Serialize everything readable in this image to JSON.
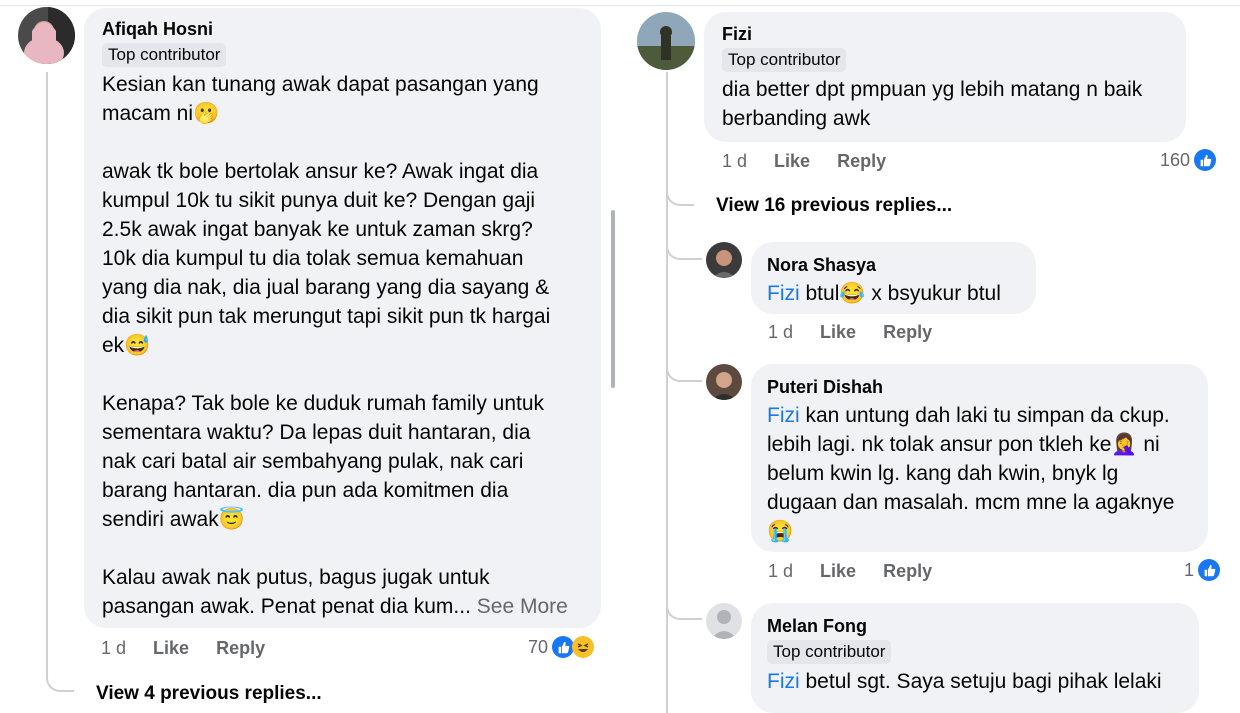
{
  "left": {
    "author": "Afiqah Hosni",
    "badge": "Top contributor",
    "paragraphs": [
      [
        "Kesian kan tunang awak dapat pasangan yang",
        "macam ni🫢"
      ],
      [
        "awak tk bole bertolak ansur ke? Awak ingat dia",
        "kumpul 10k tu sikit punya duit ke? Dengan gaji",
        "2.5k awak ingat banyak ke untuk zaman skrg?",
        "10k dia kumpul tu dia tolak semua kemahuan",
        "yang dia nak, dia jual barang yang dia sayang &",
        "dia sikit pun tak merungut tapi sikit pun tk hargai",
        "ek😅"
      ],
      [
        "Kenapa? Tak bole ke duduk rumah family untuk",
        "sementara waktu? Da lepas duit hantaran, dia",
        "nak cari batal air sembahyang pulak, nak cari",
        "barang hantaran. dia pun ada komitmen dia",
        "sendiri awak😇"
      ],
      [
        "Kalau awak nak putus, bagus jugak untuk",
        "pasangan awak. Penat penat dia kum..."
      ]
    ],
    "see_more": "See More",
    "time": "1 d",
    "like": "Like",
    "reply": "Reply",
    "reaction_count": "70",
    "view_replies": "View 4 previous replies..."
  },
  "right": {
    "fizi": {
      "author": "Fizi",
      "badge": "Top contributor",
      "lines": [
        "dia better dpt pmpuan yg lebih matang n baik",
        "berbanding awk"
      ],
      "time": "1 d",
      "like": "Like",
      "reply": "Reply",
      "reaction_count": "160"
    },
    "view_replies": "View 16 previous replies...",
    "nora": {
      "author": "Nora Shasya",
      "mention": "Fizi",
      "text_a": " btul😂 x bsyukur btul",
      "time": "1 d",
      "like": "Like",
      "reply": "Reply"
    },
    "puteri": {
      "author": "Puteri Dishah",
      "mention": "Fizi",
      "line1": " kan untung dah laki tu simpan da ckup.",
      "line2": "lebih lagi. nk tolak ansur pon tkleh ke🤦‍♀️ ni",
      "line3": "belum kwin lg. kang dah kwin, bnyk lg",
      "line4": "dugaan dan masalah. mcm mne la agaknye",
      "line5": "😭",
      "time": "1 d",
      "like": "Like",
      "reply": "Reply",
      "reaction_count": "1"
    },
    "melan": {
      "author": "Melan Fong",
      "badge": "Top contributor",
      "mention": "Fizi",
      "text": " betul sgt. Saya setuju bagi pihak lelaki"
    }
  },
  "colors": {
    "bubble": "#f0f2f5",
    "mention": "#1877f2",
    "meta": "#65676b",
    "like_blue": "#1877f2"
  },
  "icons": [
    "like-icon",
    "haha-icon"
  ]
}
